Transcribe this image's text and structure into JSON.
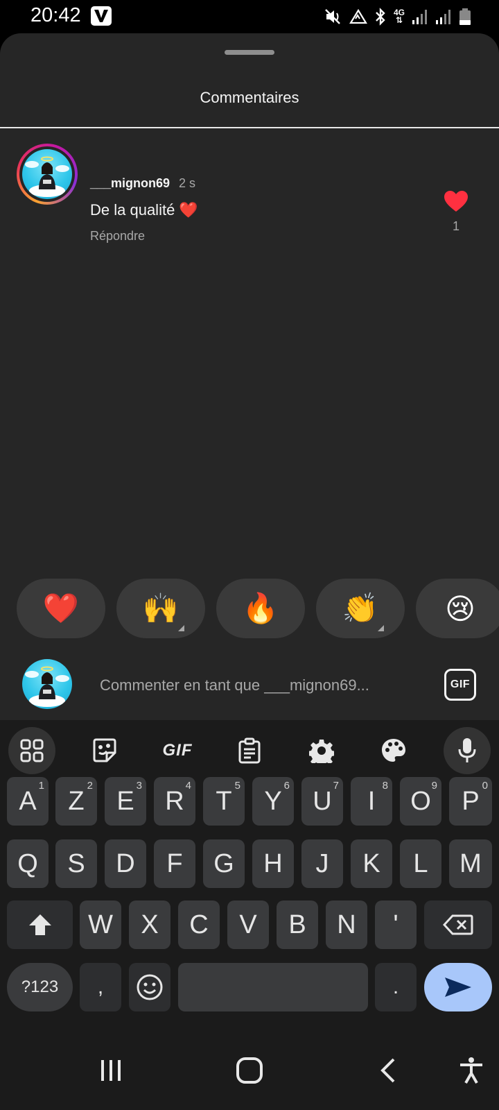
{
  "status_bar": {
    "time": "20:42",
    "network": "4G"
  },
  "sheet": {
    "title": "Commentaires"
  },
  "comment": {
    "username": "___mignon69",
    "time": "2 s",
    "text": "De la qualité ❤️",
    "reply_label": "Répondre",
    "like_count": "1"
  },
  "reactions": [
    "❤️",
    "🙌",
    "🔥",
    "👏",
    "😢"
  ],
  "input": {
    "placeholder": "Commenter en tant que ___mignon69...",
    "gif_label": "GIF"
  },
  "keyboard": {
    "toolbar_gif_label": "GIF",
    "row1": [
      {
        "key": "A",
        "hint": "1"
      },
      {
        "key": "Z",
        "hint": "2"
      },
      {
        "key": "E",
        "hint": "3"
      },
      {
        "key": "R",
        "hint": "4"
      },
      {
        "key": "T",
        "hint": "5"
      },
      {
        "key": "Y",
        "hint": "6"
      },
      {
        "key": "U",
        "hint": "7"
      },
      {
        "key": "I",
        "hint": "8"
      },
      {
        "key": "O",
        "hint": "9"
      },
      {
        "key": "P",
        "hint": "0"
      }
    ],
    "row2": [
      "Q",
      "S",
      "D",
      "F",
      "G",
      "H",
      "J",
      "K",
      "L",
      "M"
    ],
    "row3": [
      "W",
      "X",
      "C",
      "V",
      "B",
      "N",
      "'"
    ],
    "symbols_label": "?123",
    "comma": ",",
    "period": "."
  },
  "colors": {
    "sheet_bg": "#262626",
    "keyboard_bg": "#1b1b1b",
    "key_bg": "#3a3b3d",
    "send_key": "#a8c7fa",
    "like_red": "#ff3040"
  }
}
